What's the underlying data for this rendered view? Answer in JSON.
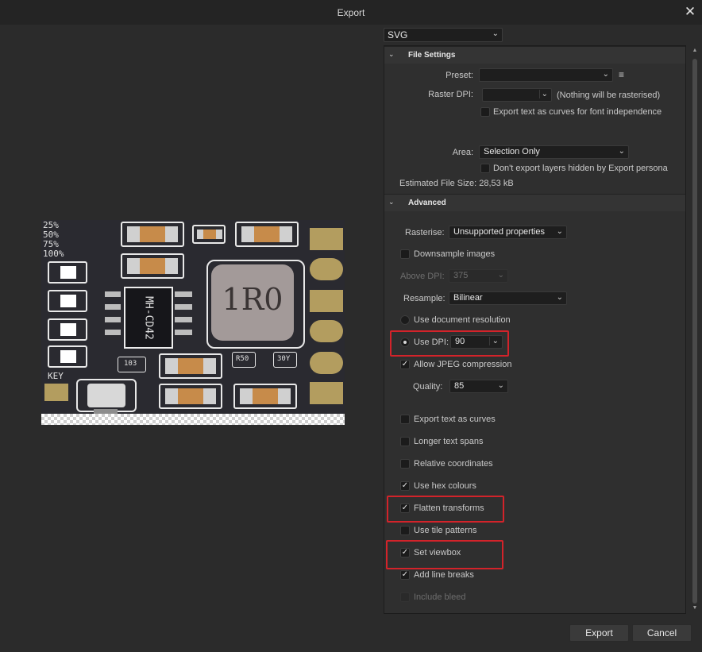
{
  "window": {
    "title": "Export",
    "close_icon": "close-icon"
  },
  "format": {
    "selected": "SVG"
  },
  "file_settings": {
    "header": "File Settings",
    "preset_label": "Preset:",
    "preset_value": "",
    "raster_dpi_label": "Raster DPI:",
    "raster_dpi_value": "",
    "raster_note": "(Nothing will be rasterised)",
    "export_text_curves_label": "Export text as curves for font independence",
    "area_label": "Area:",
    "area_value": "Selection Only",
    "dont_export_hidden_label": "Don't export layers hidden by Export persona",
    "estimated_size": "Estimated File Size: 28,53 kB"
  },
  "advanced": {
    "header": "Advanced",
    "rasterise_label": "Rasterise:",
    "rasterise_value": "Unsupported properties",
    "downsample_label": "Downsample images",
    "above_dpi_label": "Above DPI:",
    "above_dpi_value": "375",
    "resample_label": "Resample:",
    "resample_value": "Bilinear",
    "use_doc_res_label": "Use document resolution",
    "use_dpi_label": "Use DPI:",
    "use_dpi_value": "90",
    "allow_jpeg_label": "Allow JPEG compression",
    "quality_label": "Quality:",
    "quality_value": "85",
    "export_text_curves_label": "Export text as curves",
    "longer_spans_label": "Longer text spans",
    "relative_coords_label": "Relative coordinates",
    "hex_colours_label": "Use hex colours",
    "flatten_label": "Flatten transforms",
    "tile_patterns_label": "Use tile patterns",
    "viewbox_label": "Set viewbox",
    "line_breaks_label": "Add line breaks",
    "bleed_label": "Include bleed"
  },
  "checkboxes": {
    "export_text_curves_font": false,
    "dont_export_hidden": false,
    "downsample": false,
    "allow_jpeg": true,
    "export_text_curves": false,
    "longer_spans": false,
    "relative_coords": false,
    "hex_colours": true,
    "flatten": true,
    "tile_patterns": false,
    "viewbox": true,
    "line_breaks": true,
    "bleed": false
  },
  "buttons": {
    "export": "Export",
    "cancel": "Cancel"
  },
  "preview": {
    "labels": [
      "25%",
      "50%",
      "75%",
      "100%"
    ],
    "key_label": "KEY",
    "chip_label": "MH-CD42",
    "inductor_label": "1R0",
    "resistor_labels": [
      "103",
      "R50",
      "30Y"
    ]
  },
  "colors": {
    "highlight": "#d3232a",
    "pcb": "#2a2a30",
    "pad_gold": "#b39d5f"
  }
}
